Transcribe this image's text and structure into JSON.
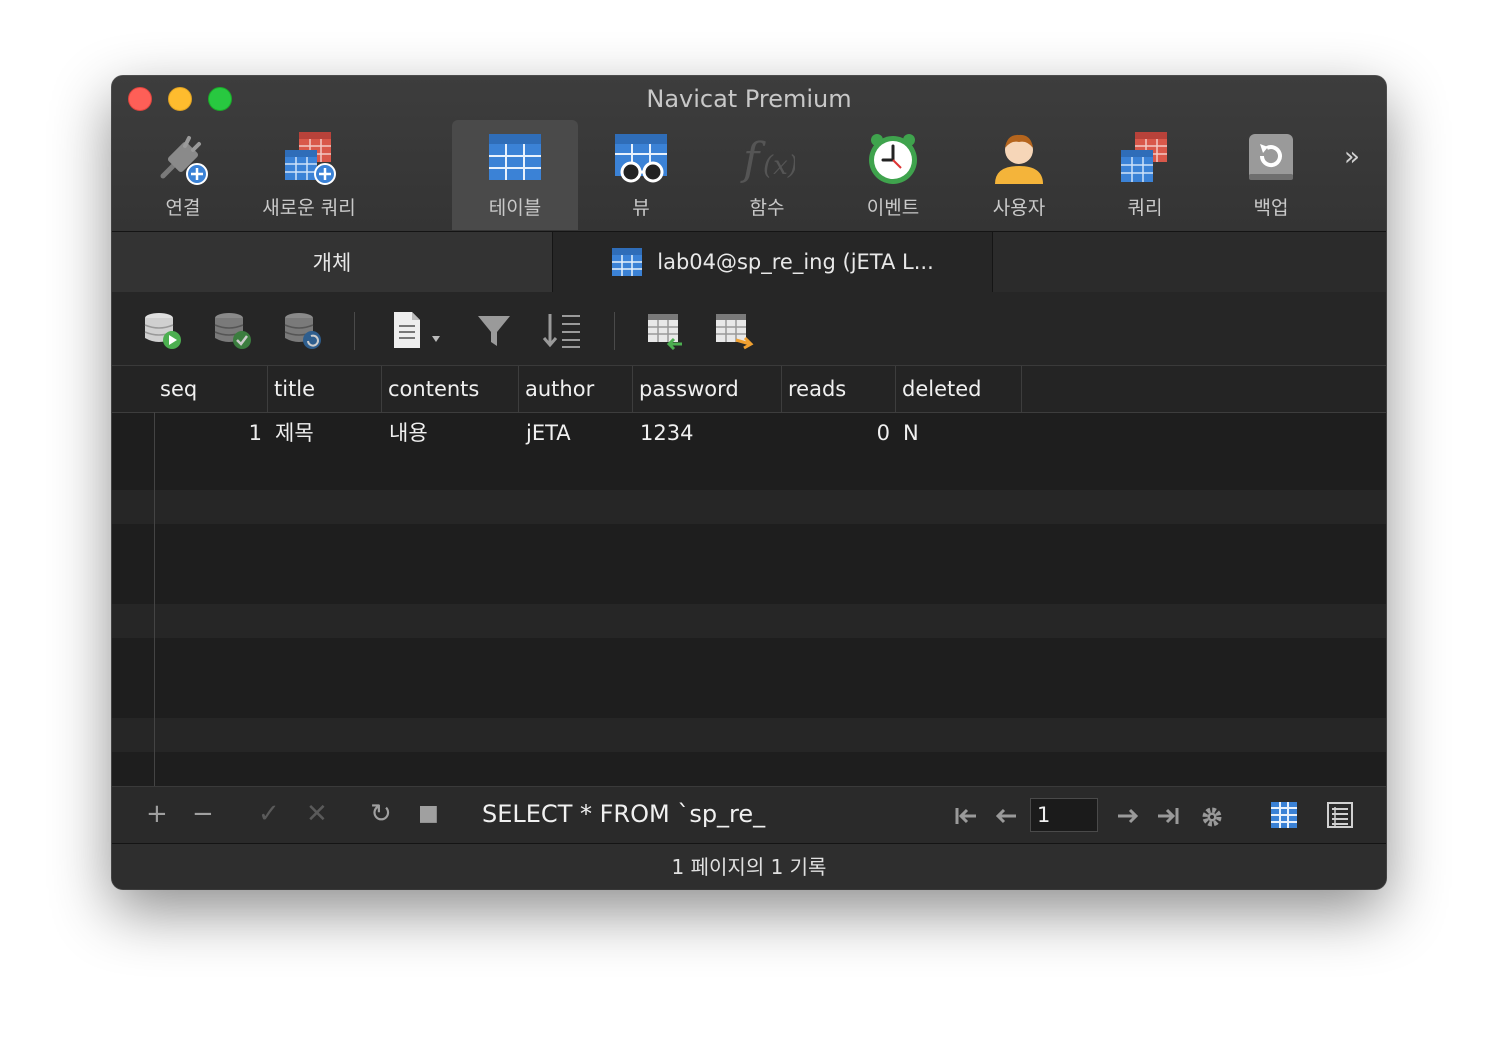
{
  "window": {
    "title": "Navicat Premium"
  },
  "toolbar": {
    "items": [
      {
        "label": "연결",
        "icon": "connection-plug-add-icon"
      },
      {
        "label": "새로운 쿼리",
        "icon": "new-query-icon"
      },
      {
        "label": "테이블",
        "icon": "table-icon",
        "active": true
      },
      {
        "label": "뷰",
        "icon": "view-icon"
      },
      {
        "label": "함수",
        "icon": "function-icon"
      },
      {
        "label": "이벤트",
        "icon": "event-clock-icon"
      },
      {
        "label": "사용자",
        "icon": "user-icon"
      },
      {
        "label": "쿼리",
        "icon": "query-icon"
      },
      {
        "label": "백업",
        "icon": "backup-icon"
      }
    ],
    "more": "»"
  },
  "tabs": {
    "objects": "개체",
    "document": "lab04@sp_re_ing (jETA L..."
  },
  "grid": {
    "columns": [
      "seq",
      "title",
      "contents",
      "author",
      "password",
      "reads",
      "deleted"
    ],
    "rows": [
      {
        "seq": "1",
        "title": "제목",
        "contents": "내용",
        "author": "jETA",
        "password": "1234",
        "reads": "0",
        "deleted": "N"
      }
    ]
  },
  "bottom": {
    "add": "+",
    "remove": "−",
    "apply": "✓",
    "discard": "✕",
    "refresh": "↻",
    "stop": "■",
    "sql": "SELECT * FROM `sp_re_",
    "page": "1"
  },
  "status": {
    "text": "1 페이지의 1 기록"
  },
  "colors": {
    "accent": "#3b82d6",
    "window_bg": "#1e1e1e",
    "toolbar_bg": "#3a3a3a"
  }
}
